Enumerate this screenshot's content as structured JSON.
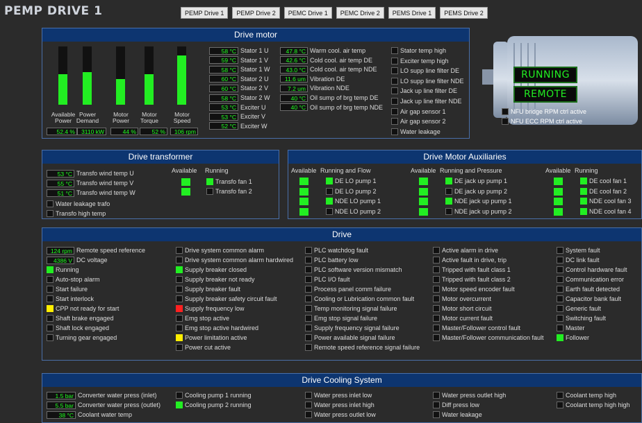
{
  "title": "PEMP DRIVE 1",
  "tabs": [
    "PEMP Drive 1",
    "PEMP Drive 2",
    "PEMC Drive 1",
    "PEMC Drive 2",
    "PEMS Drive 1",
    "PEMS Drive 2"
  ],
  "drive_motor": {
    "title": "Drive motor",
    "bars": [
      {
        "label": "Available Power",
        "value": "52.4 %",
        "level": 0.52
      },
      {
        "label": "Power Demand",
        "value": "3110 kW",
        "level": 0.56
      },
      {
        "label": "Motor Power",
        "value": "44 %",
        "level": 0.44
      },
      {
        "label": "Motor Torque",
        "value": "52 %",
        "level": 0.52
      },
      {
        "label": "Motor Speed",
        "value": "106 rpm",
        "level": 0.85
      }
    ],
    "temps": [
      {
        "value": "58 °C",
        "label": "Stator 1 U"
      },
      {
        "value": "59 °C",
        "label": "Stator 1 V"
      },
      {
        "value": "58 °C",
        "label": "Stator 1 W"
      },
      {
        "value": "60 °C",
        "label": "Stator 2 U"
      },
      {
        "value": "60 °C",
        "label": "Stator 2 V"
      },
      {
        "value": "58 °C",
        "label": "Stator 2 W"
      },
      {
        "value": "53 °C",
        "label": "Exciter U"
      },
      {
        "value": "53 °C",
        "label": "Exciter V"
      },
      {
        "value": "52 °C",
        "label": "Exciter W"
      }
    ],
    "others": [
      {
        "value": "47.8 °C",
        "label": "Warm cool. air temp"
      },
      {
        "value": "42.6 °C",
        "label": "Cold cool. air temp DE"
      },
      {
        "value": "43.0 °C",
        "label": "Cold cool. air temp NDE"
      },
      {
        "value": "11.6 um",
        "label": "Vibration DE"
      },
      {
        "value": "7.2 um",
        "label": "Vibration NDE"
      },
      {
        "value": "40 °C",
        "label": "Oil sump of brg temp DE"
      },
      {
        "value": "40 °C",
        "label": "Oil sump of brg temp NDE"
      }
    ],
    "alarms": [
      "Stator temp high",
      "Exciter temp high",
      "LO supp line filter DE",
      "LO supp line filter NDE",
      "Jack up line filter DE",
      "Jack up line filter NDE",
      "Air gap sensor 1",
      "Air gap sensor 2",
      "Water leakage"
    ],
    "status": [
      "RUNNING",
      "REMOTE"
    ],
    "nfu": [
      "NFU bridge RPM ctrl active",
      "NFU ECC RPM ctrl active"
    ]
  },
  "transformer": {
    "title": "Drive transformer",
    "temps": [
      {
        "value": "53 °C",
        "label": "Transfo wind temp U"
      },
      {
        "value": "55 °C",
        "label": "Transfo wind temp V"
      },
      {
        "value": "51 °C",
        "label": "Transfo wind temp W"
      }
    ],
    "alarms": [
      "Water leakage trafo",
      "Transfo high temp"
    ],
    "col_available": "Available",
    "col_running": "Running",
    "fans": [
      {
        "label": "Transfo fan 1",
        "running": true
      },
      {
        "label": "Transfo fan 2",
        "running": false
      }
    ]
  },
  "aux": {
    "title": "Drive Motor Auxiliaries",
    "groups": [
      {
        "h1": "Available",
        "h2": "Running and Flow",
        "items": [
          {
            "label": "DE LO pump 1",
            "on": true
          },
          {
            "label": "DE LO pump 2",
            "on": false
          },
          {
            "label": "NDE LO pump 1",
            "on": true
          },
          {
            "label": "NDE LO pump 2",
            "on": false
          }
        ]
      },
      {
        "h1": "Available",
        "h2": "Running and Pressure",
        "items": [
          {
            "label": "DE jack up pump 1",
            "on": true
          },
          {
            "label": "DE jack up pump 2",
            "on": false
          },
          {
            "label": "NDE jack up pump 1",
            "on": true
          },
          {
            "label": "NDE jack up pump 2",
            "on": false
          }
        ]
      },
      {
        "h1": "Available",
        "h2": "Running",
        "items": [
          {
            "label": "DE cool fan 1",
            "on": true
          },
          {
            "label": "DE cool fan 2",
            "on": true
          },
          {
            "label": "NDE cool fan 3",
            "on": true
          },
          {
            "label": "NDE cool fan 4",
            "on": true
          }
        ]
      }
    ]
  },
  "drive": {
    "title": "Drive",
    "values": [
      {
        "value": "124 rpm",
        "label": "Remote speed reference"
      },
      {
        "value": "4386 V",
        "label": "DC voltage"
      }
    ],
    "col1": [
      {
        "label": "Running",
        "s": "g"
      },
      {
        "label": "Auto-stop alarm",
        "s": ""
      },
      {
        "label": "Start failure",
        "s": ""
      },
      {
        "label": "Start interlock",
        "s": ""
      },
      {
        "label": "CPP not ready for start",
        "s": "y"
      },
      {
        "label": "Shaft brake engaged",
        "s": ""
      },
      {
        "label": "Shaft lock engaged",
        "s": ""
      },
      {
        "label": "Turning gear engaged",
        "s": ""
      }
    ],
    "col2": [
      {
        "label": "Drive system common alarm",
        "s": ""
      },
      {
        "label": "Drive system common alarm hardwired",
        "s": ""
      },
      {
        "label": "Supply breaker closed",
        "s": "g"
      },
      {
        "label": "Supply breaker not ready",
        "s": ""
      },
      {
        "label": "Supply breaker fault",
        "s": ""
      },
      {
        "label": "Supply breaker safety circuit fault",
        "s": ""
      },
      {
        "label": "Supply frequency low",
        "s": "r"
      },
      {
        "label": "Emg stop active",
        "s": ""
      },
      {
        "label": "Emg stop active hardwired",
        "s": ""
      },
      {
        "label": "Power limitation active",
        "s": "y"
      },
      {
        "label": "Power cut active",
        "s": ""
      }
    ],
    "col3": [
      {
        "label": "PLC watchdog fault",
        "s": ""
      },
      {
        "label": "PLC battery low",
        "s": ""
      },
      {
        "label": "PLC software version mismatch",
        "s": ""
      },
      {
        "label": "PLC I/O fault",
        "s": ""
      },
      {
        "label": "Process panel comm failure",
        "s": ""
      },
      {
        "label": "Cooling or Lubrication common fault",
        "s": ""
      },
      {
        "label": "Temp monitoring signal failure",
        "s": ""
      },
      {
        "label": "Emg stop signal failure",
        "s": ""
      },
      {
        "label": "Supply frequency signal failure",
        "s": ""
      },
      {
        "label": "Power available signal failure",
        "s": ""
      },
      {
        "label": "Remote speed reference signal failure",
        "s": ""
      }
    ],
    "col4": [
      {
        "label": "Active alarm in drive",
        "s": ""
      },
      {
        "label": "Active fault in drive, trip",
        "s": ""
      },
      {
        "label": "Tripped with fault class 1",
        "s": ""
      },
      {
        "label": "Tripped with fault class 2",
        "s": ""
      },
      {
        "label": "Motor speed encoder fault",
        "s": ""
      },
      {
        "label": "Motor overcurrent",
        "s": ""
      },
      {
        "label": "Motor short circuit",
        "s": ""
      },
      {
        "label": "Motor current fault",
        "s": ""
      },
      {
        "label": "Master/Follower control fault",
        "s": ""
      },
      {
        "label": "Master/Follower communication fault",
        "s": ""
      }
    ],
    "col5": [
      {
        "label": "System fault",
        "s": ""
      },
      {
        "label": "DC link fault",
        "s": ""
      },
      {
        "label": "Control hardware fault",
        "s": ""
      },
      {
        "label": "Communication error",
        "s": ""
      },
      {
        "label": "Earth fault detected",
        "s": ""
      },
      {
        "label": "Capacitor bank fault",
        "s": ""
      },
      {
        "label": "Generic fault",
        "s": ""
      },
      {
        "label": "Switching fault",
        "s": ""
      },
      {
        "label": "Master",
        "s": ""
      },
      {
        "label": "Follower",
        "s": "g"
      }
    ]
  },
  "cooling": {
    "title": "Drive Cooling System",
    "values": [
      {
        "value": "1.5 bar",
        "label": "Converter water press (inlet)"
      },
      {
        "value": "5.5 bar",
        "label": "Converter water press (outlet)"
      },
      {
        "value": "38 °C",
        "label": "Coolant water temp"
      }
    ],
    "col2": [
      {
        "label": "Cooling pump 1 running",
        "s": ""
      },
      {
        "label": "Cooling pump 2 running",
        "s": "g"
      }
    ],
    "col3": [
      {
        "label": "Water press inlet low",
        "s": ""
      },
      {
        "label": "Water press inlet high",
        "s": ""
      },
      {
        "label": "Water press outlet low",
        "s": ""
      }
    ],
    "col4": [
      {
        "label": "Water press outlet high",
        "s": ""
      },
      {
        "label": "Diff press low",
        "s": ""
      },
      {
        "label": "Water leakage",
        "s": ""
      }
    ],
    "col5": [
      {
        "label": "Coolant temp high",
        "s": ""
      },
      {
        "label": "Coolant temp high high",
        "s": ""
      }
    ]
  }
}
